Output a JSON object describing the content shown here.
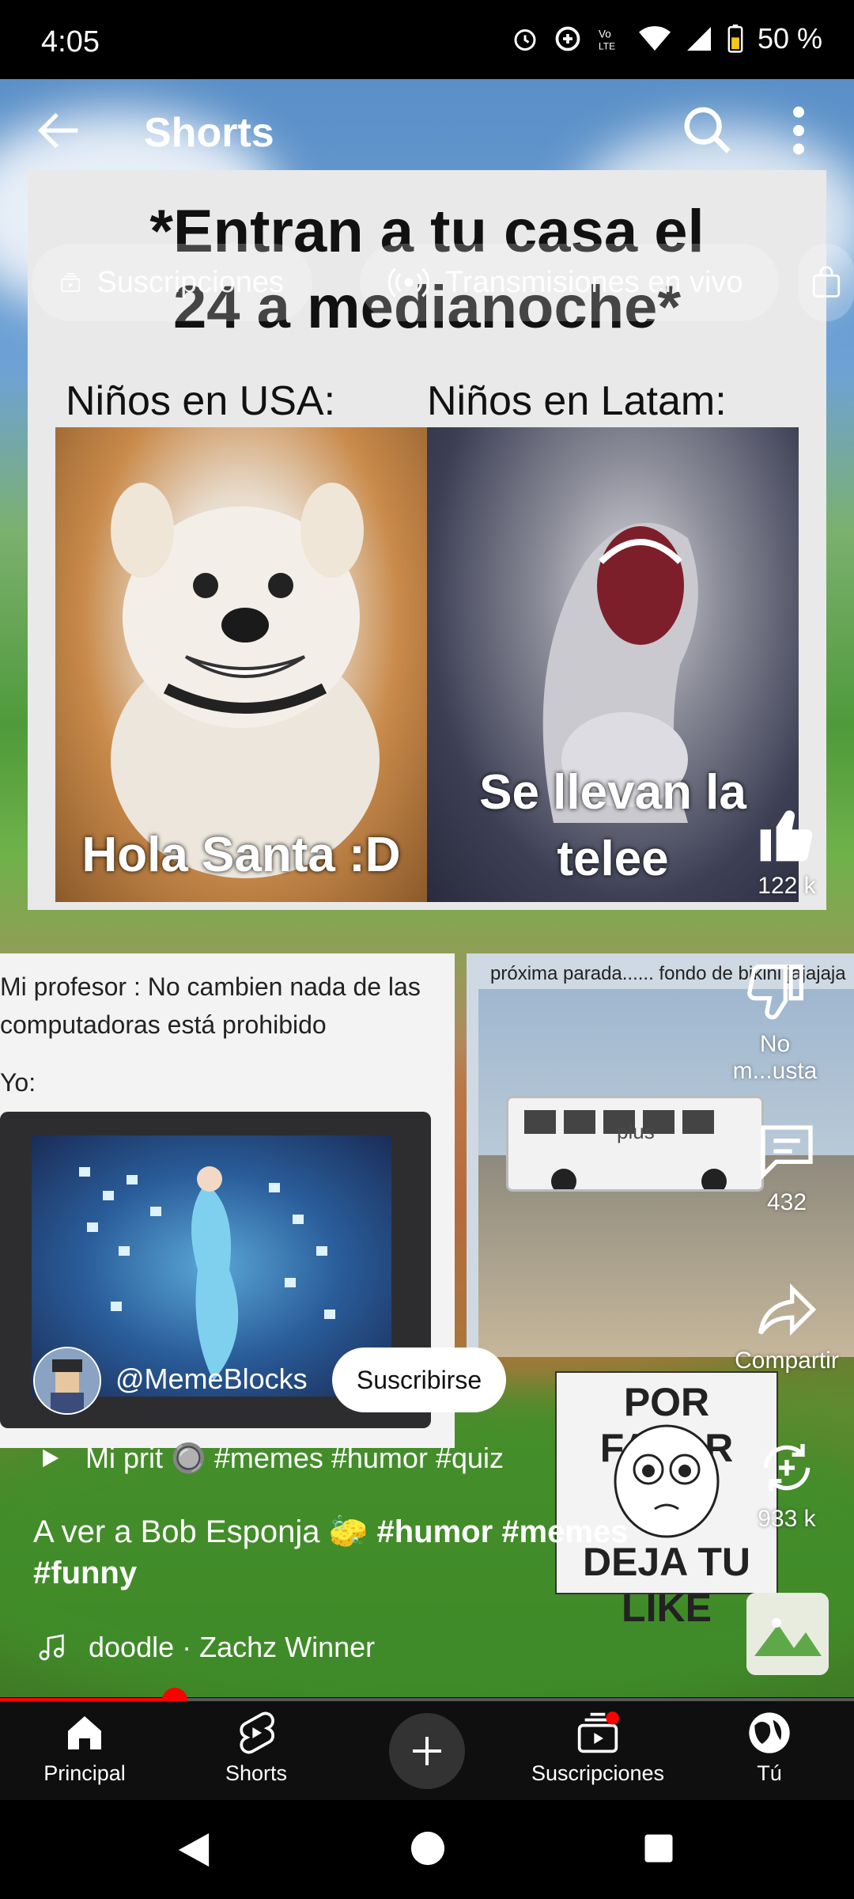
{
  "status_bar": {
    "time": "4:05",
    "battery": "50 %"
  },
  "header": {
    "title": "Shorts"
  },
  "chips": [
    {
      "label": "Suscripciones"
    },
    {
      "label": "Transmisiones en vivo"
    }
  ],
  "meme_top": {
    "title_line1": "*Entran a tu casa el",
    "title_line2": "24 a medianoche*",
    "left_label": "Niños en USA:",
    "right_label": "Niños en Latam:",
    "left_caption": "Hola Santa :D",
    "right_caption_line1": "Se llevan la",
    "right_caption_line2": "telee"
  },
  "meme_prof": {
    "text": "Mi profesor : No cambien nada de las computadoras está prohibido",
    "yo": "Yo:"
  },
  "meme_bus": {
    "caption": "próxima parada...... fondo de bikini jajajaja",
    "bus_text": "plus"
  },
  "actions": {
    "like_count": "122 k",
    "dislike_label": "No m...usta",
    "comments_count": "432",
    "share_label": "Compartir",
    "remix_count": "933 k"
  },
  "sticker": {
    "top": "POR FAVOR",
    "bottom": "DEJA TU LIKE"
  },
  "channel": {
    "handle": "@MemeBlocks",
    "subscribe_label": "Suscribirse"
  },
  "playlist": {
    "text": "Mi prit 🔘 #memes #humor #quiz"
  },
  "description": {
    "text": "A ver a Bob Esponja 🧽 ",
    "tag1": "#humor",
    "tag2": "#memes",
    "tag3": "#funny"
  },
  "music": {
    "text": "doodle · Zachz Winner"
  },
  "progress": {
    "fraction": 0.205
  },
  "nav": [
    {
      "label": "Principal"
    },
    {
      "label": "Shorts"
    },
    {
      "label": "Suscripciones"
    },
    {
      "label": "Tú"
    }
  ]
}
